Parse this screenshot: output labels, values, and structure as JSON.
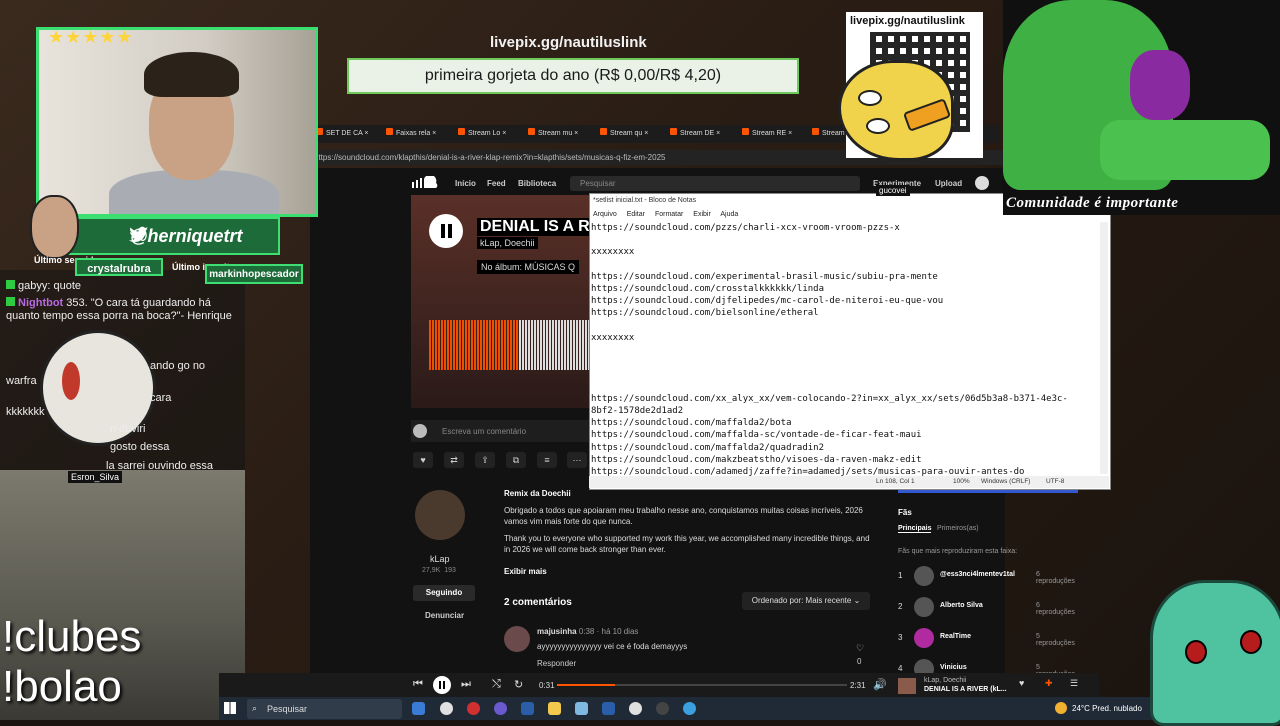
{
  "overlay": {
    "tip_url": "livepix.gg/nautiluslink",
    "tip_goal": "primeira gorjeta do ano (R$ 0,00/R$ 4,20)",
    "qr_label": "livepix.gg/nautiluslink",
    "community": "Comunidade é importante",
    "twitter_handle": "@herniquetrt",
    "last_follower_label": "Último seguidor:",
    "last_follower": "crystalrubra",
    "last_sub_label": "Último inscrito:",
    "last_sub": "markinhopescador",
    "stars": "★★★★★",
    "cmd1": "!clubes",
    "cmd2": "!bolao",
    "tag": "Esron_Silva",
    "gucovei": "gucovei"
  },
  "chat": [
    {
      "name": "",
      "text": "gabyy: quote"
    },
    {
      "name": "Nightbot",
      "text": "353. \"O cara tá guardando há quanto tempo essa porra na boca?\"- Henrique"
    },
    {
      "name": "",
      "text": "ando go no"
    },
    {
      "name": "",
      "text": "warfra"
    },
    {
      "name": "",
      "text": "cara"
    },
    {
      "name": "",
      "text": "kkkkkkk"
    },
    {
      "name": "",
      "text": "n duviri"
    },
    {
      "name": "",
      "text": "gosto dessa"
    },
    {
      "name": "",
      "text": "la sarrei ouvindo essa track ai"
    }
  ],
  "browser": {
    "tabs": [
      "SET DE CA",
      "Faixas rela",
      "Stream Lo",
      "Stream mu",
      "Stream qu",
      "Stream DE",
      "Stream RE",
      "Stream"
    ],
    "url": "https://soundcloud.com/klapthis/denial-is-a-river-klap-remix?in=klapthis/sets/musicas-q-fiz-em-2025"
  },
  "soundcloud": {
    "nav": [
      "Início",
      "Feed",
      "Biblioteca"
    ],
    "search_placeholder": "Pesquisar",
    "upload": "Upload",
    "premium": "Experimente",
    "track_title": "DENIAL IS A RIV",
    "track_artist": "kLap, Doechii",
    "album": "No álbum: MÚSICAS Q",
    "comment_placeholder": "Escreva um comentário",
    "remix_of": "Remix da Doechii",
    "desc_pt": "Obrigado a todos que apoiaram meu trabalho nesse ano, conquistamos muitas coisas incríveis, 2026 vamos vim mais forte do que nunca.",
    "desc_en": "Thank you to everyone who supported my work this year, we accomplished many incredible things, and in 2026 we will come back stronger than ever.",
    "show_more": "Exibir mais",
    "artist_name": "kLap",
    "artist_followers": "27,9K",
    "artist_tracks": "193",
    "following_btn": "Seguindo",
    "report_btn": "Denunciar",
    "comments_count": "2 comentários",
    "sort_label": "Ordenado por: Mais recente",
    "comment": {
      "user": "majusinha",
      "time": "0:38 · há 10 dias",
      "text": "ayyyyyyyyyyyyyyy vei ce é foda demayyys",
      "reply": "Responder",
      "likes": "0"
    },
    "fans": {
      "title": "Fãs",
      "tab1": "Principais",
      "tab2": "Primeiros(as)",
      "subtitle": "Fãs que mais reproduziram esta faixa:",
      "rows": [
        {
          "rank": "1",
          "name": "@ess3nci4lmentev1tal",
          "plays": "6 reproduções"
        },
        {
          "rank": "2",
          "name": "Alberto Silva",
          "plays": "6 reproduções"
        },
        {
          "rank": "3",
          "name": "RealTime",
          "plays": "5 reproduções"
        },
        {
          "rank": "4",
          "name": "Vinicius",
          "plays": "5 reproduções"
        }
      ]
    }
  },
  "notepad": {
    "title": "*setlist inicial.txt - Bloco de Notas",
    "menu": [
      "Arquivo",
      "Editar",
      "Formatar",
      "Exibir",
      "Ajuda"
    ],
    "content": "https://soundcloud.com/pzzs/charli-xcx-vroom-vroom-pzzs-x\n\nxxxxxxxx\n\nhttps://soundcloud.com/experimental-brasil-music/subiu-pra-mente\nhttps://soundcloud.com/crosstalkkkkkk/linda\nhttps://soundcloud.com/djfelipedes/mc-carol-de-niteroi-eu-que-vou\nhttps://soundcloud.com/bielsonline/etheral\n\nxxxxxxxx\n\n\n\n\nhttps://soundcloud.com/xx_alyx_xx/vem-colocando-2?in=xx_alyx_xx/sets/06d5b3a8-b371-4e3c-\n8bf2-1578de2d1ad2\nhttps://soundcloud.com/maffalda2/bota\nhttps://soundcloud.com/maffalda-sc/vontade-de-ficar-feat-maui\nhttps://soundcloud.com/maffalda2/quadradin2\nhttps://soundcloud.com/makzbeatstho/visoes-da-raven-makz-edit\nhttps://soundcloud.com/adamedj/zaffe?in=adamedj/sets/musicas-para-ouvir-antes-do",
    "status_pos": "Ln 108, Col 1",
    "status_zoom": "100%",
    "status_eol": "Windows (CRLF)",
    "status_enc": "UTF-8"
  },
  "player": {
    "elapsed": "0:31",
    "duration": "2:31",
    "progress": 0.2,
    "artist": "kLap, Doechii",
    "title": "DENIAL IS A RIVER (kL..."
  },
  "taskbar": {
    "search": "Pesquisar",
    "weather": "24°C  Pred. nublado"
  },
  "colors": {
    "accent": "#ff5500",
    "overlay_green": "#3ede73",
    "taskbar": "#202a36"
  }
}
